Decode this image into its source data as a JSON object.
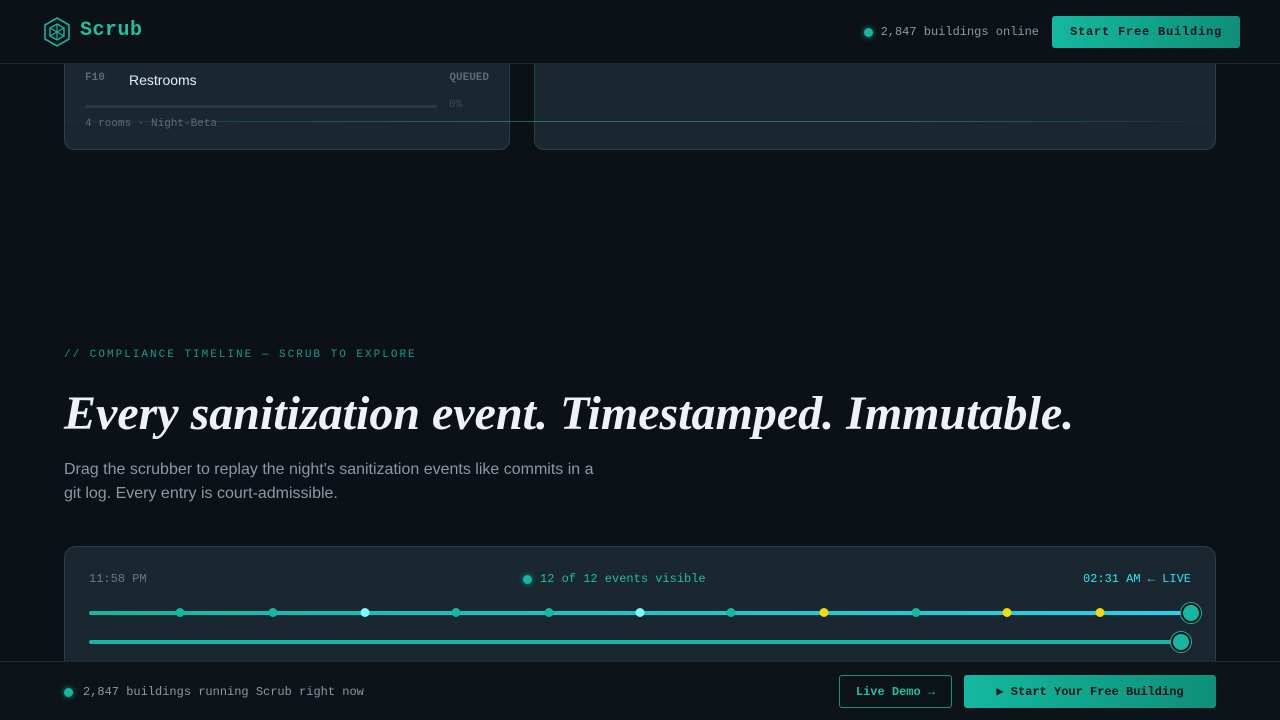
{
  "header": {
    "brand": "Scrub",
    "online_text": "2,847 buildings online",
    "cta_label": "Start Free Building"
  },
  "task_card": {
    "code": "F10",
    "name": "Restrooms",
    "status": "QUEUED",
    "progress_percent": 0,
    "progress_label": "0%",
    "meta": "4 rooms · Night-Beta"
  },
  "section": {
    "eyebrow": "// COMPLIANCE TIMELINE — SCRUB TO EXPLORE",
    "headline": "Every sanitization event. Timestamped. Immutable.",
    "lede": "Drag the scrubber to replay the night's sanitization events like commits in a git log. Every entry is court-admissible."
  },
  "timeline": {
    "start_time": "11:58 PM",
    "visible_count": "12 of 12 events visible",
    "end_label": "02:31 AM ← LIVE",
    "scrub_fraction": 1.0,
    "events": [
      {
        "pos": 0.083,
        "color": "#14b8a0"
      },
      {
        "pos": 0.167,
        "color": "#14b8a0"
      },
      {
        "pos": 0.25,
        "color": "#7ef9ff"
      },
      {
        "pos": 0.333,
        "color": "#14b8a0"
      },
      {
        "pos": 0.417,
        "color": "#14b8a0"
      },
      {
        "pos": 0.5,
        "color": "#7ef9ff"
      },
      {
        "pos": 0.583,
        "color": "#14b8a0"
      },
      {
        "pos": 0.667,
        "color": "#f5d90a"
      },
      {
        "pos": 0.75,
        "color": "#14b8a0"
      },
      {
        "pos": 0.833,
        "color": "#f5d90a"
      },
      {
        "pos": 0.917,
        "color": "#f5d90a"
      }
    ]
  },
  "bottom_bar": {
    "status_text": "2,847 buildings running Scrub right now",
    "demo_label": "Live Demo →",
    "cta_label": "▶ Start Your Free Building"
  },
  "colors": {
    "accent": "#14b8a0",
    "live": "#2ee6f0",
    "warning": "#f5d90a",
    "background": "#0b1117",
    "panel": "#1a2630"
  }
}
